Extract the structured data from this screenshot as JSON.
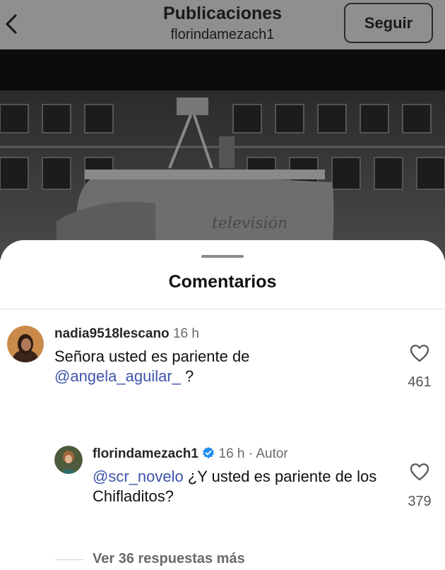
{
  "header": {
    "title": "Publicaciones",
    "subtitle": "florindamezach1",
    "follow_label": "Seguir"
  },
  "sheet": {
    "title": "Comentarios"
  },
  "comments": [
    {
      "username": "nadia9518lescano",
      "time": "16 h",
      "text": "Señora usted es pariente de",
      "mention": "@angela_aguilar_",
      "text_end": " ?",
      "likes": "461"
    }
  ],
  "reply": {
    "username": "florindamezach1",
    "time": "16 h",
    "separator": "·",
    "role": "Autor",
    "mention": "@scr_novelo",
    "text": " ¿Y usted es pariente de los Chifladitos?",
    "likes": "379",
    "verified": true
  },
  "more_replies_label": "Ver 36 respuestas más",
  "icons": {
    "back": "chevron-left-icon",
    "like": "heart-icon",
    "verified": "verified-badge-icon"
  },
  "colors": {
    "mention": "#3d54a8",
    "verified": "#1f8df0"
  }
}
